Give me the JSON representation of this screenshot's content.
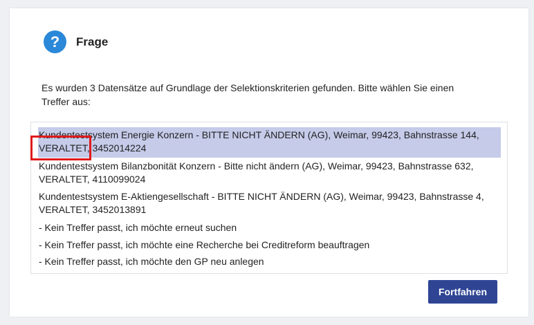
{
  "dialog": {
    "title": "Frage",
    "icon": "question-icon",
    "icon_glyph": "?",
    "message": "Es wurden 3 Datensätze auf Grundlage der Selektionskriterien gefunden. Bitte wählen Sie einen Treffer aus:",
    "options": [
      {
        "label": "Kundentestsystem Energie Konzern - BITTE NICHT ÄNDERN (AG), Weimar, 99423, Bahnstrasse 144, VERALTET, 3452014224",
        "selected": true
      },
      {
        "label": "Kundentestsystem Bilanzbonität Konzern - Bitte nicht ändern (AG), Weimar, 99423, Bahnstrasse 632, VERALTET, 4110099024",
        "selected": false
      },
      {
        "label": "Kundentestsystem E-Aktiengesellschaft - BITTE NICHT ÄNDERN (AG), Weimar, 99423, Bahnstrasse 4, VERALTET, 3452013891",
        "selected": false
      },
      {
        "label": "- Kein Treffer passt, ich möchte erneut suchen",
        "selected": false
      },
      {
        "label": "- Kein Treffer passt, ich möchte eine Recherche bei Creditreform beauftragen",
        "selected": false
      },
      {
        "label": "- Kein Treffer passt, ich möchte den GP neu anlegen",
        "selected": false
      }
    ],
    "continue_label": "Fortfahren"
  },
  "colors": {
    "accent": "#2f4594",
    "selection": "#c5cbe9",
    "icon": "#2b88d8",
    "highlight": "#e01b1b"
  }
}
